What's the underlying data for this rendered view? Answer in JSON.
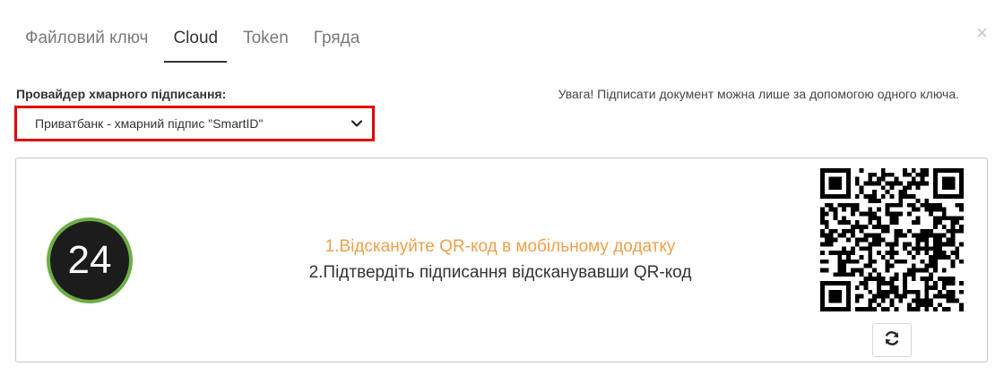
{
  "tabs": [
    {
      "label": "Файловий ключ"
    },
    {
      "label": "Cloud"
    },
    {
      "label": "Token"
    },
    {
      "label": "Гряда"
    }
  ],
  "close_label": "×",
  "provider": {
    "label": "Провайдер хмарного підписання:",
    "selected": "Приватбанк - хмарний підпис \"SmartID\""
  },
  "warning": "Увага! Підписати документ можна лише за допомогою одного ключа.",
  "panel": {
    "countdown": "24",
    "step1": "1.Відскануйте QR-код в мобільному додатку",
    "step2": "2.Підтвердіть підписання відсканувавши QR-код"
  },
  "colors": {
    "accent_orange": "#f0a04b",
    "timer_ring": "#6dae46",
    "highlight_border": "#e00000"
  },
  "icons": {
    "select_arrow": "chevron-down-icon",
    "refresh": "refresh-icon",
    "close": "close-icon"
  }
}
